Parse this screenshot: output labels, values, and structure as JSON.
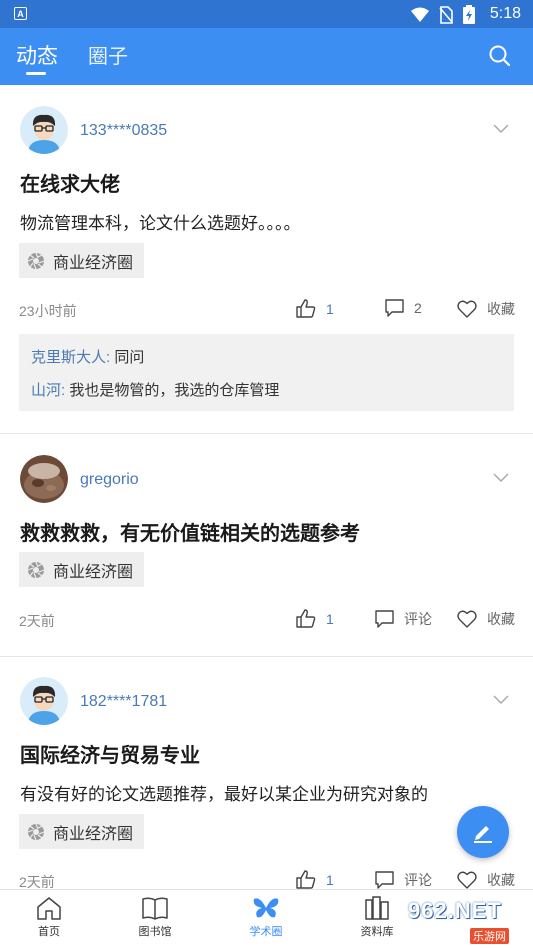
{
  "statusbar": {
    "time": "5:18"
  },
  "topbar": {
    "tabs": [
      {
        "label": "动态"
      },
      {
        "label": "圈子"
      }
    ]
  },
  "posts": [
    {
      "username": "133****0835",
      "title": "在线求大佬",
      "body": "物流管理本科，论文什么选题好。。。。",
      "tag": "商业经济圈",
      "time": "23小时前",
      "likes": "1",
      "comments_label": "2",
      "favorite": "收藏",
      "comment_list": [
        {
          "name": "克里斯大人:",
          "text": " 同问"
        },
        {
          "name": "山河:",
          "text": " 我也是物管的，我选的仓库管理"
        }
      ]
    },
    {
      "username": "gregorio",
      "title": "救救救救，有无价值链相关的选题参考",
      "tag": "商业经济圈",
      "time": "2天前",
      "likes": "1",
      "comments_label": "评论",
      "favorite": "收藏"
    },
    {
      "username": "182****1781",
      "title": "国际经济与贸易专业",
      "body": "有没有好的论文选题推荐，最好以某企业为研究对象的",
      "tag": "商业经济圈",
      "time": "2天前",
      "likes": "1",
      "comments_label": "评论",
      "favorite": "收藏"
    }
  ],
  "bottomnav": {
    "items": [
      {
        "label": "首页",
        "icon": "home-icon"
      },
      {
        "label": "图书馆",
        "icon": "book-icon"
      },
      {
        "label": "学术圈",
        "icon": "butterfly-icon"
      },
      {
        "label": "资料库",
        "icon": "library-icon"
      }
    ]
  },
  "watermark": {
    "text": "962.NET",
    "sub": "乐游网"
  },
  "colors": {
    "primary": "#3c8ef3",
    "statusbar": "#2f74d0",
    "link": "#4a7ab5"
  }
}
